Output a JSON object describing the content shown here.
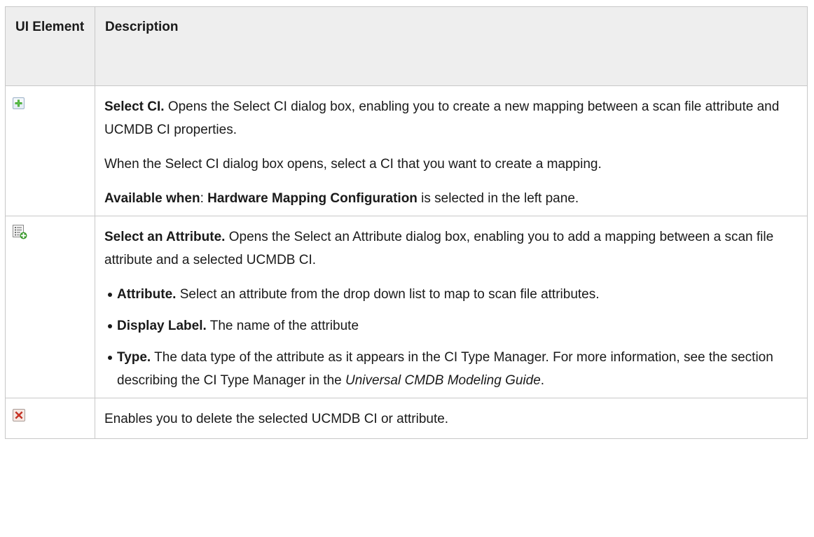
{
  "header": {
    "col_element": "UI Element",
    "col_description": "Description"
  },
  "rows": [
    {
      "icon": "green-plus-icon",
      "title": "Select CI.",
      "text": " Opens the Select CI dialog box, enabling you to create a new mapping between a scan file attribute and UCMDB CI properties.",
      "para2": "When the Select CI dialog box opens, select a CI that you want to create a mapping.",
      "para3_label": "Available when",
      "para3_sep": ": ",
      "para3_bold": "Hardware Mapping Configuration",
      "para3_rest": " is selected in the left pane."
    },
    {
      "icon": "list-add-icon",
      "title": "Select an Attribute.",
      "text": " Opens the Select an Attribute dialog box, enabling you to add a mapping between a scan file attribute and a selected UCMDB CI.",
      "bullets": [
        {
          "term": "Attribute.",
          "text": " Select an attribute from the drop down list to map to scan file attributes."
        },
        {
          "term": "Display Label.",
          "text": " The name of the attribute"
        },
        {
          "term": "Type.",
          "text": " The data type of the attribute as it appears in the CI Type Manager. For more information, see the section describing the CI Type Manager in the ",
          "italic": "Universal CMDB Modeling Guide",
          "end": "."
        }
      ]
    },
    {
      "icon": "red-x-delete-icon",
      "text": "Enables you to delete the selected UCMDB CI or attribute."
    }
  ]
}
